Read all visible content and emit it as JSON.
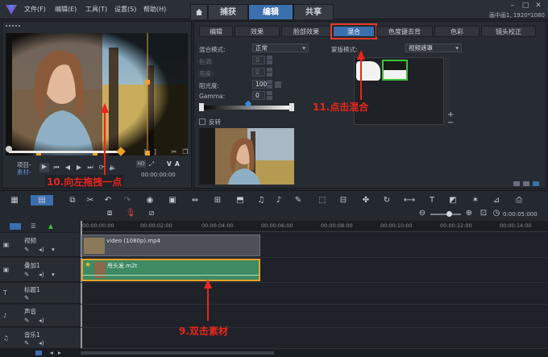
{
  "menu": [
    "文件(F)",
    "编辑(E)",
    "工具(T)",
    "设置(S)",
    "帮助(H)"
  ],
  "mode_tabs": [
    {
      "label": "捕获",
      "active": false
    },
    {
      "label": "编辑",
      "active": true
    },
    {
      "label": "共享",
      "active": false
    }
  ],
  "home_icon": "home-icon",
  "project_info": "画中画1, 1920*1080",
  "preview": {
    "project_label": "项目-",
    "clip_label": "素材-",
    "timecode": "00:00:00:00",
    "mark_labels": [
      "[",
      "]"
    ]
  },
  "options": {
    "tabs": [
      "编辑",
      "效果",
      "脸部效果",
      "混合",
      "色度键去背",
      "色彩",
      "镜头校正"
    ],
    "active_tab": "混合",
    "blend_mode_label": "混合模式:",
    "blend_mode_value": "正常",
    "hue_label": "色调:",
    "hue_value": "0",
    "brightness_label": "亮度:",
    "brightness_value": "0",
    "opacity_label": "阻光度:",
    "opacity_value": "100",
    "gamma_label": "Gamma:",
    "gamma_value": "0",
    "invert_label": "反转",
    "mask_mode_label": "蒙版模式:",
    "mask_mode_value": "视频遮罩"
  },
  "timeline": {
    "timecodes": [
      "00:00:00:00",
      "00:00:02:00",
      "00:00:04:00",
      "00:00:06:00",
      "00:00:08:00",
      "00:00:10:00",
      "00:00:12:00",
      "00:00:14:00"
    ],
    "zoom_time": "0:00:05:000",
    "tracks": [
      {
        "name": "视频"
      },
      {
        "name": "叠加1"
      },
      {
        "name": "标题1"
      },
      {
        "name": "声音"
      },
      {
        "name": "音乐1"
      }
    ],
    "video_clip": "video (1080p).mp4",
    "overlay_clip": "甩头发.m2t"
  },
  "annotations": {
    "step9": "9.双击素材",
    "step10": "10.向左拖拽一点",
    "step11": "11.点击混合"
  },
  "colors": {
    "accent": "#3b6fae",
    "annotation": "#e8261b",
    "overlay_clip": "#3e8a63",
    "video_clip": "#4d5058"
  }
}
